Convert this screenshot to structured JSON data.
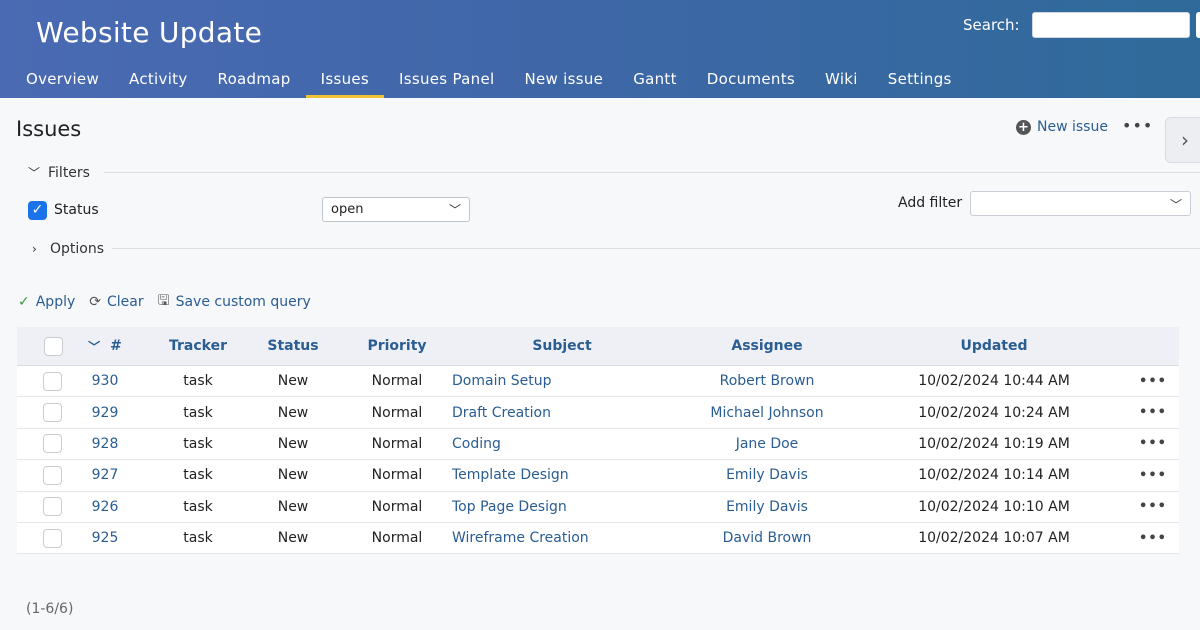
{
  "project": {
    "title": "Website Update"
  },
  "search": {
    "label": "Search:",
    "value": ""
  },
  "tabs": [
    {
      "label": "Overview"
    },
    {
      "label": "Activity"
    },
    {
      "label": "Roadmap"
    },
    {
      "label": "Issues",
      "active": true
    },
    {
      "label": "Issues Panel"
    },
    {
      "label": "New issue"
    },
    {
      "label": "Gantt"
    },
    {
      "label": "Documents"
    },
    {
      "label": "Wiki"
    },
    {
      "label": "Settings"
    }
  ],
  "page": {
    "title": "Issues",
    "new_issue_label": "New issue",
    "more_icon": "ellipsis-icon",
    "side_toggle_icon": "chevron-right-icon"
  },
  "filters": {
    "section_label": "Filters",
    "status_label": "Status",
    "status_checked": true,
    "status_value": "open",
    "add_filter_label": "Add filter",
    "add_filter_value": ""
  },
  "options": {
    "section_label": "Options"
  },
  "actions": {
    "apply_label": "Apply",
    "clear_label": "Clear",
    "save_label": "Save custom query"
  },
  "table": {
    "columns": {
      "id": "#",
      "tracker": "Tracker",
      "status": "Status",
      "priority": "Priority",
      "subject": "Subject",
      "assignee": "Assignee",
      "updated": "Updated"
    },
    "rows": [
      {
        "id": "930",
        "tracker": "task",
        "status": "New",
        "priority": "Normal",
        "subject": "Domain Setup",
        "assignee": "Robert Brown",
        "updated": "10/02/2024 10:44 AM"
      },
      {
        "id": "929",
        "tracker": "task",
        "status": "New",
        "priority": "Normal",
        "subject": "Draft Creation",
        "assignee": "Michael Johnson",
        "updated": "10/02/2024 10:24 AM"
      },
      {
        "id": "928",
        "tracker": "task",
        "status": "New",
        "priority": "Normal",
        "subject": "Coding",
        "assignee": "Jane Doe",
        "updated": "10/02/2024 10:19 AM"
      },
      {
        "id": "927",
        "tracker": "task",
        "status": "New",
        "priority": "Normal",
        "subject": "Template Design",
        "assignee": "Emily Davis",
        "updated": "10/02/2024 10:14 AM"
      },
      {
        "id": "926",
        "tracker": "task",
        "status": "New",
        "priority": "Normal",
        "subject": "Top Page Design",
        "assignee": "Emily Davis",
        "updated": "10/02/2024 10:10 AM"
      },
      {
        "id": "925",
        "tracker": "task",
        "status": "New",
        "priority": "Normal",
        "subject": "Wireframe Creation",
        "assignee": "David Brown",
        "updated": "10/02/2024 10:07 AM"
      }
    ]
  },
  "pagination": {
    "label": "(1-6/6)"
  },
  "colors": {
    "header": "#3f67a8",
    "active_tab": "#f1c232",
    "link": "#2a5d91",
    "checkbox": "#1a73e8"
  }
}
